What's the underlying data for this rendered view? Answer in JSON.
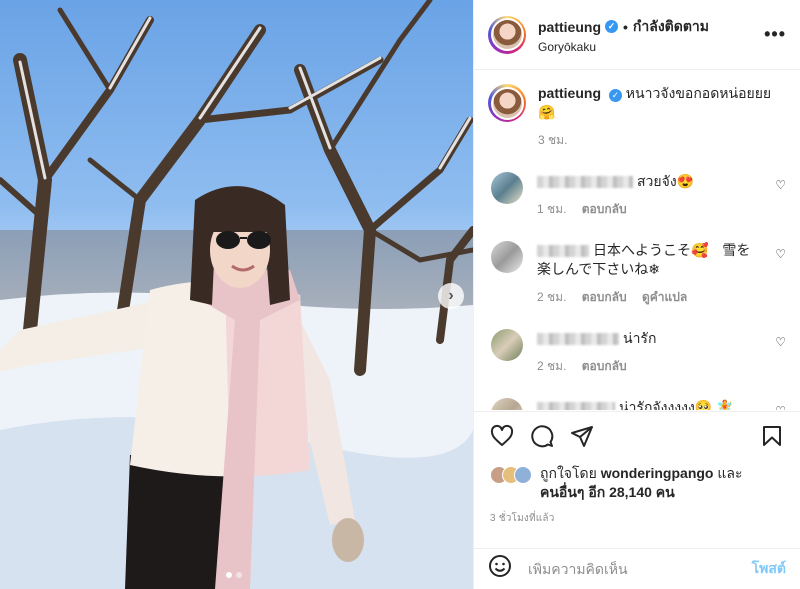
{
  "post": {
    "username": "pattieung",
    "dot": "•",
    "follow_status": "กำลังติดตาม",
    "location": "Goryōkaku",
    "more_label": "•••",
    "caption": "หนาวจังขอกอดหน่อยยย🤗",
    "caption_time": "3 ชม.",
    "next_label": "›"
  },
  "comments": [
    {
      "text": "สวยจัง😍",
      "time": "1 ชม.",
      "reply": "ตอบกลับ",
      "translate": ""
    },
    {
      "text": "日本へようこそ🥰　雪を楽しんで下さいね❄",
      "time": "2 ชม.",
      "reply": "ตอบกลับ",
      "translate": "ดูคำแปล"
    },
    {
      "text": "น่ารัก",
      "time": "2 ชม.",
      "reply": "ตอบกลับ",
      "translate": ""
    },
    {
      "text": "น่ารักจังงงงง🥺 🧚",
      "time": "",
      "reply": "",
      "translate": ""
    }
  ],
  "likes": {
    "prefix": "ถูกใจโดย",
    "user": "wonderingpango",
    "conj": "และ",
    "others": "คนอื่นๆ อีก 28,140 คน"
  },
  "posted_ago": "3 ชั่วโมงที่แล้ว",
  "add_comment": {
    "placeholder": "เพิ่มความคิดเห็น",
    "post_label": "โพสต์"
  },
  "icons": {
    "verified": "verified-badge-icon",
    "heart": "heart-icon",
    "comment": "comment-icon",
    "share": "share-icon",
    "bookmark": "bookmark-icon",
    "emoji": "emoji-icon"
  }
}
